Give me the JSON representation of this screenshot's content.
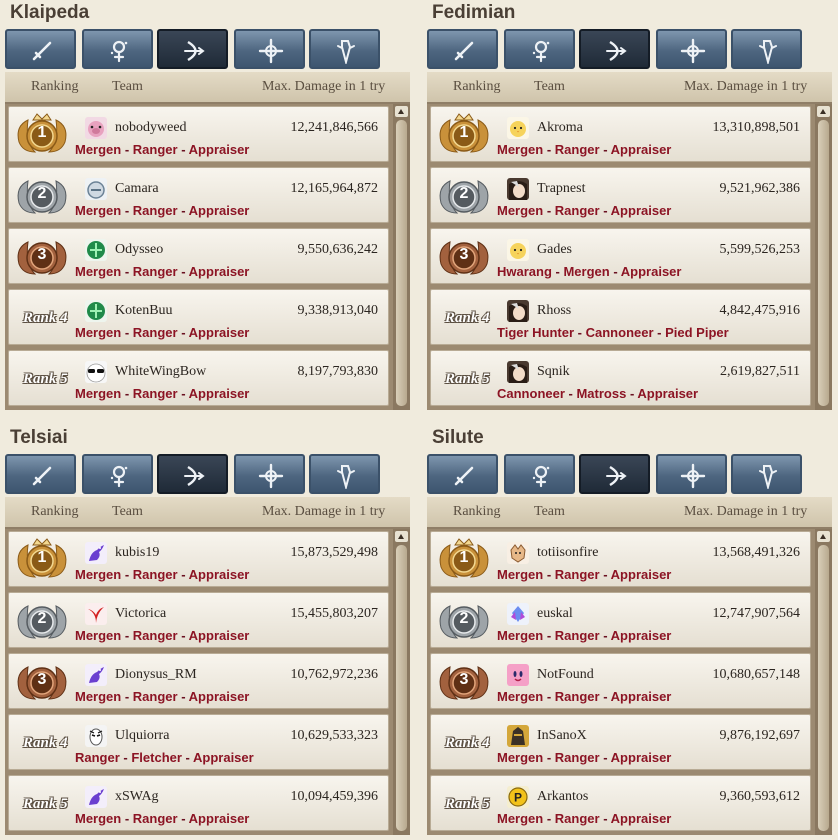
{
  "columns": {
    "ranking": "Ranking",
    "team": "Team",
    "damage": "Max. Damage in 1 try"
  },
  "tab_icons": [
    "sword-icon",
    "wizard-icon",
    "bow-icon",
    "cleric-cross-icon",
    "scout-icon"
  ],
  "active_tab": 2,
  "rank_labels": [
    "Rank 4",
    "Rank 5"
  ],
  "colors": {
    "class_text": "#8c1424",
    "gold": "#c9913a",
    "silver": "#9ea4a8",
    "bronze": "#a2613e",
    "tab_active": "#1f2a37",
    "tab": "#4e6680"
  },
  "panels": [
    {
      "title": "Klaipeda",
      "entries": [
        {
          "name": "nobodyweed",
          "damage": "12,241,846,566",
          "avatar": "pink-pig-avatar",
          "classes": [
            "Mergen",
            "Ranger",
            "Appraiser"
          ]
        },
        {
          "name": "Camara",
          "damage": "12,165,964,872",
          "avatar": "white-creature-avatar",
          "classes": [
            "Mergen",
            "Ranger",
            "Appraiser"
          ]
        },
        {
          "name": "Odysseo",
          "damage": "9,550,636,242",
          "avatar": "green-orb-avatar",
          "classes": [
            "Mergen",
            "Ranger",
            "Appraiser"
          ]
        },
        {
          "name": "KotenBuu",
          "damage": "9,338,913,040",
          "avatar": "green-orb-avatar",
          "classes": [
            "Mergen",
            "Ranger",
            "Appraiser"
          ]
        },
        {
          "name": "WhiteWingBow",
          "damage": "8,197,793,830",
          "avatar": "sunglasses-avatar",
          "classes": [
            "Mergen",
            "Ranger",
            "Appraiser"
          ]
        }
      ]
    },
    {
      "title": "Fedimian",
      "entries": [
        {
          "name": "Akroma",
          "damage": "13,310,898,501",
          "avatar": "yellow-chick-avatar",
          "classes": [
            "Mergen",
            "Ranger",
            "Appraiser"
          ]
        },
        {
          "name": "Trapnest",
          "damage": "9,521,962,386",
          "avatar": "anime-portrait-avatar",
          "classes": [
            "Mergen",
            "Ranger",
            "Appraiser"
          ]
        },
        {
          "name": "Gades",
          "damage": "5,599,526,253",
          "avatar": "yellow-chick-avatar",
          "classes": [
            "Hwarang",
            "Mergen",
            "Appraiser"
          ]
        },
        {
          "name": "Rhoss",
          "damage": "4,842,475,916",
          "avatar": "anime-portrait-avatar",
          "classes": [
            "Tiger Hunter",
            "Cannoneer",
            "Pied Piper"
          ]
        },
        {
          "name": "Sqnik",
          "damage": "2,619,827,511",
          "avatar": "anime-portrait-avatar",
          "classes": [
            "Cannoneer",
            "Matross",
            "Appraiser"
          ]
        }
      ]
    },
    {
      "title": "Telsiai",
      "entries": [
        {
          "name": "kubis19",
          "damage": "15,873,529,498",
          "avatar": "purple-dragon-avatar",
          "classes": [
            "Mergen",
            "Ranger",
            "Appraiser"
          ]
        },
        {
          "name": "Victorica",
          "damage": "15,455,803,207",
          "avatar": "red-bird-avatar",
          "classes": [
            "Mergen",
            "Ranger",
            "Appraiser"
          ]
        },
        {
          "name": "Dionysus_RM",
          "damage": "10,762,972,236",
          "avatar": "purple-dragon-avatar",
          "classes": [
            "Mergen",
            "Ranger",
            "Appraiser"
          ]
        },
        {
          "name": "Ulquiorra",
          "damage": "10,629,533,323",
          "avatar": "masked-face-avatar",
          "classes": [
            "Ranger",
            "Fletcher",
            "Appraiser"
          ]
        },
        {
          "name": "xSWAg",
          "damage": "10,094,459,396",
          "avatar": "purple-dragon-avatar",
          "classes": [
            "Mergen",
            "Ranger",
            "Appraiser"
          ]
        }
      ]
    },
    {
      "title": "Silute",
      "entries": [
        {
          "name": "totiisonfire",
          "damage": "13,568,491,326",
          "avatar": "fox-avatar",
          "classes": [
            "Mergen",
            "Ranger",
            "Appraiser"
          ]
        },
        {
          "name": "euskal",
          "damage": "12,747,907,564",
          "avatar": "blue-crystal-avatar",
          "classes": [
            "Mergen",
            "Ranger",
            "Appraiser"
          ]
        },
        {
          "name": "NotFound",
          "damage": "10,680,657,148",
          "avatar": "pink-face-avatar",
          "classes": [
            "Mergen",
            "Ranger",
            "Appraiser"
          ]
        },
        {
          "name": "InSanoX",
          "damage": "9,876,192,697",
          "avatar": "dark-knight-avatar",
          "classes": [
            "Mergen",
            "Ranger",
            "Appraiser"
          ]
        },
        {
          "name": "Arkantos",
          "damage": "9,360,593,612",
          "avatar": "p-coin-avatar",
          "classes": [
            "Mergen",
            "Ranger",
            "Appraiser"
          ]
        }
      ]
    }
  ]
}
